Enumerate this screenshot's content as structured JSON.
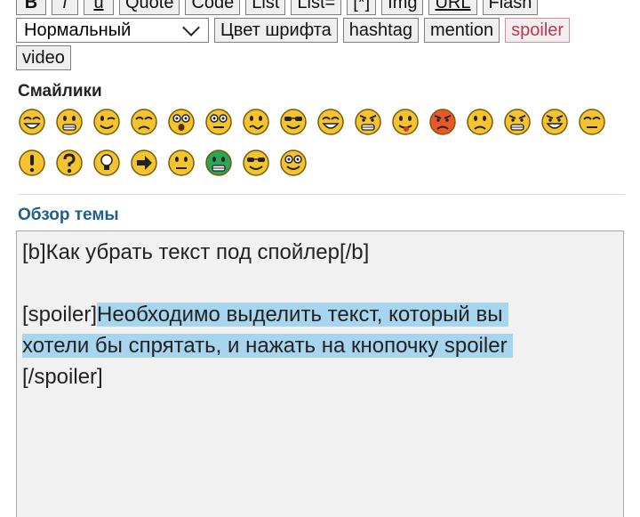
{
  "toolbar": {
    "row1": [
      "B",
      "i",
      "u",
      "Quote",
      "Code",
      "List",
      "List=",
      "[*]",
      "Img",
      "URL",
      "Flash"
    ],
    "font_size_select": "Нормальный",
    "font_color": "Цвет шрифта",
    "hashtag": "hashtag",
    "mention": "mention",
    "spoiler": "spoiler",
    "video": "video"
  },
  "smilies": {
    "title": "Смайлики",
    "row1": [
      "laughing-face",
      "grin-face",
      "wink-face",
      "sad-face",
      "shocked-face",
      "dizzy-face",
      "confused-face",
      "cool-face",
      "big-grin-face",
      "angry-squint-face",
      "tongue-face",
      "mad-face",
      "frown-face",
      "evil-face",
      "twisted-evil-face",
      "neutral-face"
    ],
    "row2": [
      "exclamation-icon",
      "question-icon",
      "idea-icon",
      "arrow-icon",
      "smirk-face",
      "green-face",
      "geek-face",
      "nerd-face"
    ]
  },
  "colors": {
    "smiley_yellow": "#f4c430",
    "smiley_red": "#e9572b",
    "smiley_green": "#2aa657",
    "heading_blue": "#1f5f8b",
    "spoiler_red": "#c0364f",
    "selection": "#a8d5ee"
  },
  "preview": {
    "title": "Обзор темы",
    "line1": "[b]Как убрать текст под спойлер[/b]",
    "line3_prefix": "[spoiler]",
    "line3_sel": "Необходимо выделить текст, который вы ",
    "line4_sel": "хотели бы спрятать, и нажать на кнопочку spoiler ",
    "line5": "[/spoiler]"
  }
}
